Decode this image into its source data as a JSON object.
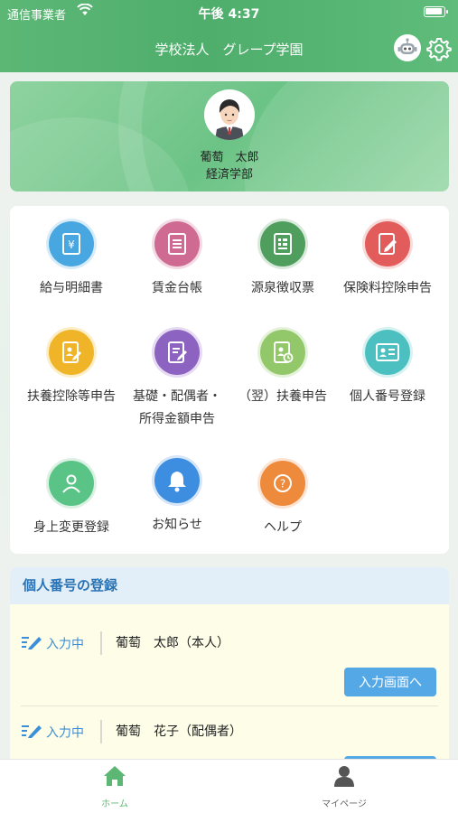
{
  "status": {
    "carrier": "通信事業者",
    "time": "午後 4:37"
  },
  "header": {
    "title": "学校法人　グレープ学園"
  },
  "profile": {
    "name": "葡萄　太郎",
    "department": "経済学部"
  },
  "menu": [
    {
      "label": "給与明細書",
      "icon": "yen-document-icon",
      "color": "#48a7e0"
    },
    {
      "label": "賃金台帳",
      "icon": "ledger-icon",
      "color": "#cf6b92"
    },
    {
      "label": "源泉徴収票",
      "icon": "withholding-slip-icon",
      "color": "#4f9e5e"
    },
    {
      "label": "保険料控除申告",
      "icon": "insurance-pen-icon",
      "color": "#e25c5c"
    },
    {
      "label": "扶養控除等申告",
      "icon": "dependent-form-icon",
      "color": "#f0b428"
    },
    {
      "label": "基礎・配偶者・所得金額申告",
      "icon": "spouse-form-icon",
      "color": "#8c63c0"
    },
    {
      "label": "（翌）扶養申告",
      "icon": "next-year-form-icon",
      "color": "#93c86a"
    },
    {
      "label": "個人番号登録",
      "icon": "id-card-icon",
      "color": "#4cc0c0"
    },
    {
      "label": "身上変更登録",
      "icon": "person-icon",
      "color": "#5ac487"
    },
    {
      "label": "お知らせ",
      "icon": "bell-icon",
      "color": "#3d8ee0"
    },
    {
      "label": "ヘルプ",
      "icon": "help-icon",
      "color": "#ee8a3c"
    }
  ],
  "registration": {
    "title": "個人番号の登録",
    "rows": [
      {
        "status": "入力中",
        "name": "葡萄　太郎（本人）",
        "button": "入力画面へ"
      },
      {
        "status": "入力中",
        "name": "葡萄　花子（配偶者）",
        "button": ""
      }
    ]
  },
  "tabbar": {
    "home": {
      "label": "ホーム",
      "color": "#5cb775"
    },
    "mypage": {
      "label": "マイページ",
      "color": "#666666"
    }
  }
}
